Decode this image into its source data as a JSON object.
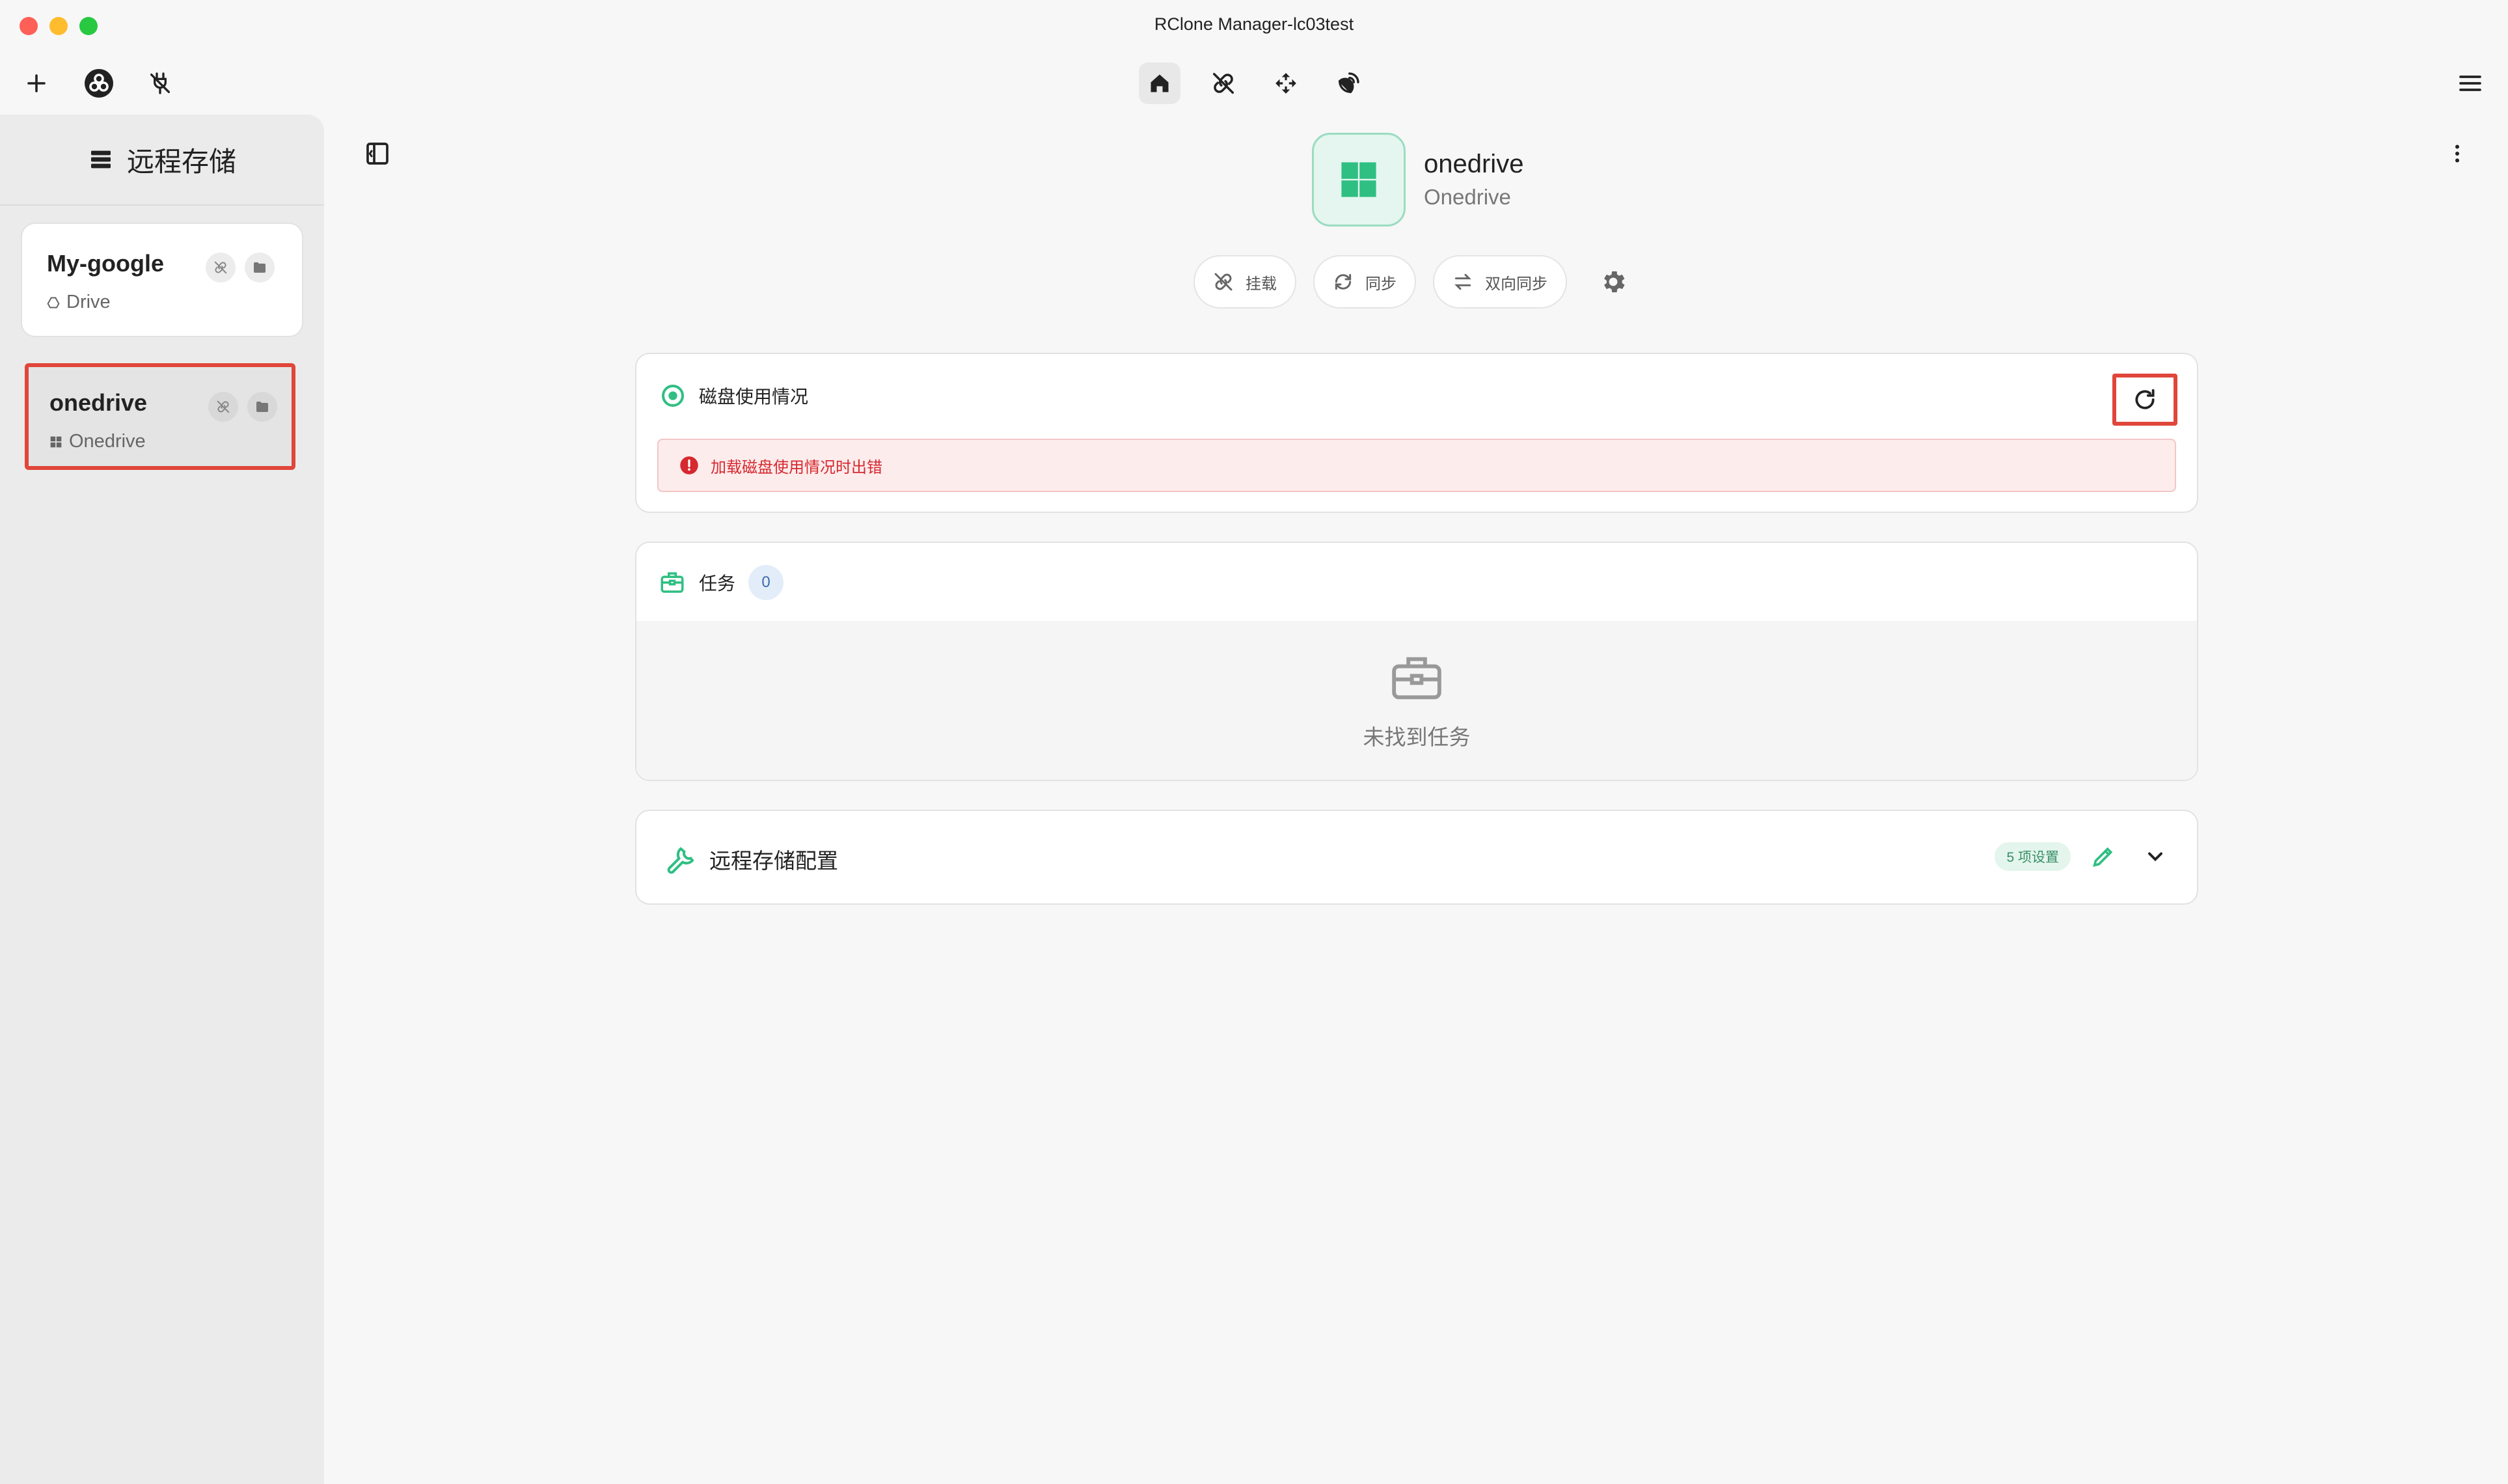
{
  "window": {
    "title": "RClone Manager-lc03test"
  },
  "sidebar": {
    "title": "远程存储",
    "remotes": [
      {
        "name": "My-google",
        "type": "Drive"
      },
      {
        "name": "onedrive",
        "type": "Onedrive",
        "selected": true
      }
    ]
  },
  "remote": {
    "name": "onedrive",
    "type": "Onedrive"
  },
  "actions": {
    "mount": "挂载",
    "sync": "同步",
    "bisync": "双向同步"
  },
  "disk_usage": {
    "title": "磁盘使用情况",
    "error": "加载磁盘使用情况时出错"
  },
  "tasks": {
    "title": "任务",
    "count": "0",
    "empty": "未找到任务"
  },
  "config": {
    "title": "远程存储配置",
    "badge": "5 项设置"
  },
  "colors": {
    "accent": "#2fbf83",
    "error": "#d6282f",
    "highlight": "#e0463a"
  }
}
